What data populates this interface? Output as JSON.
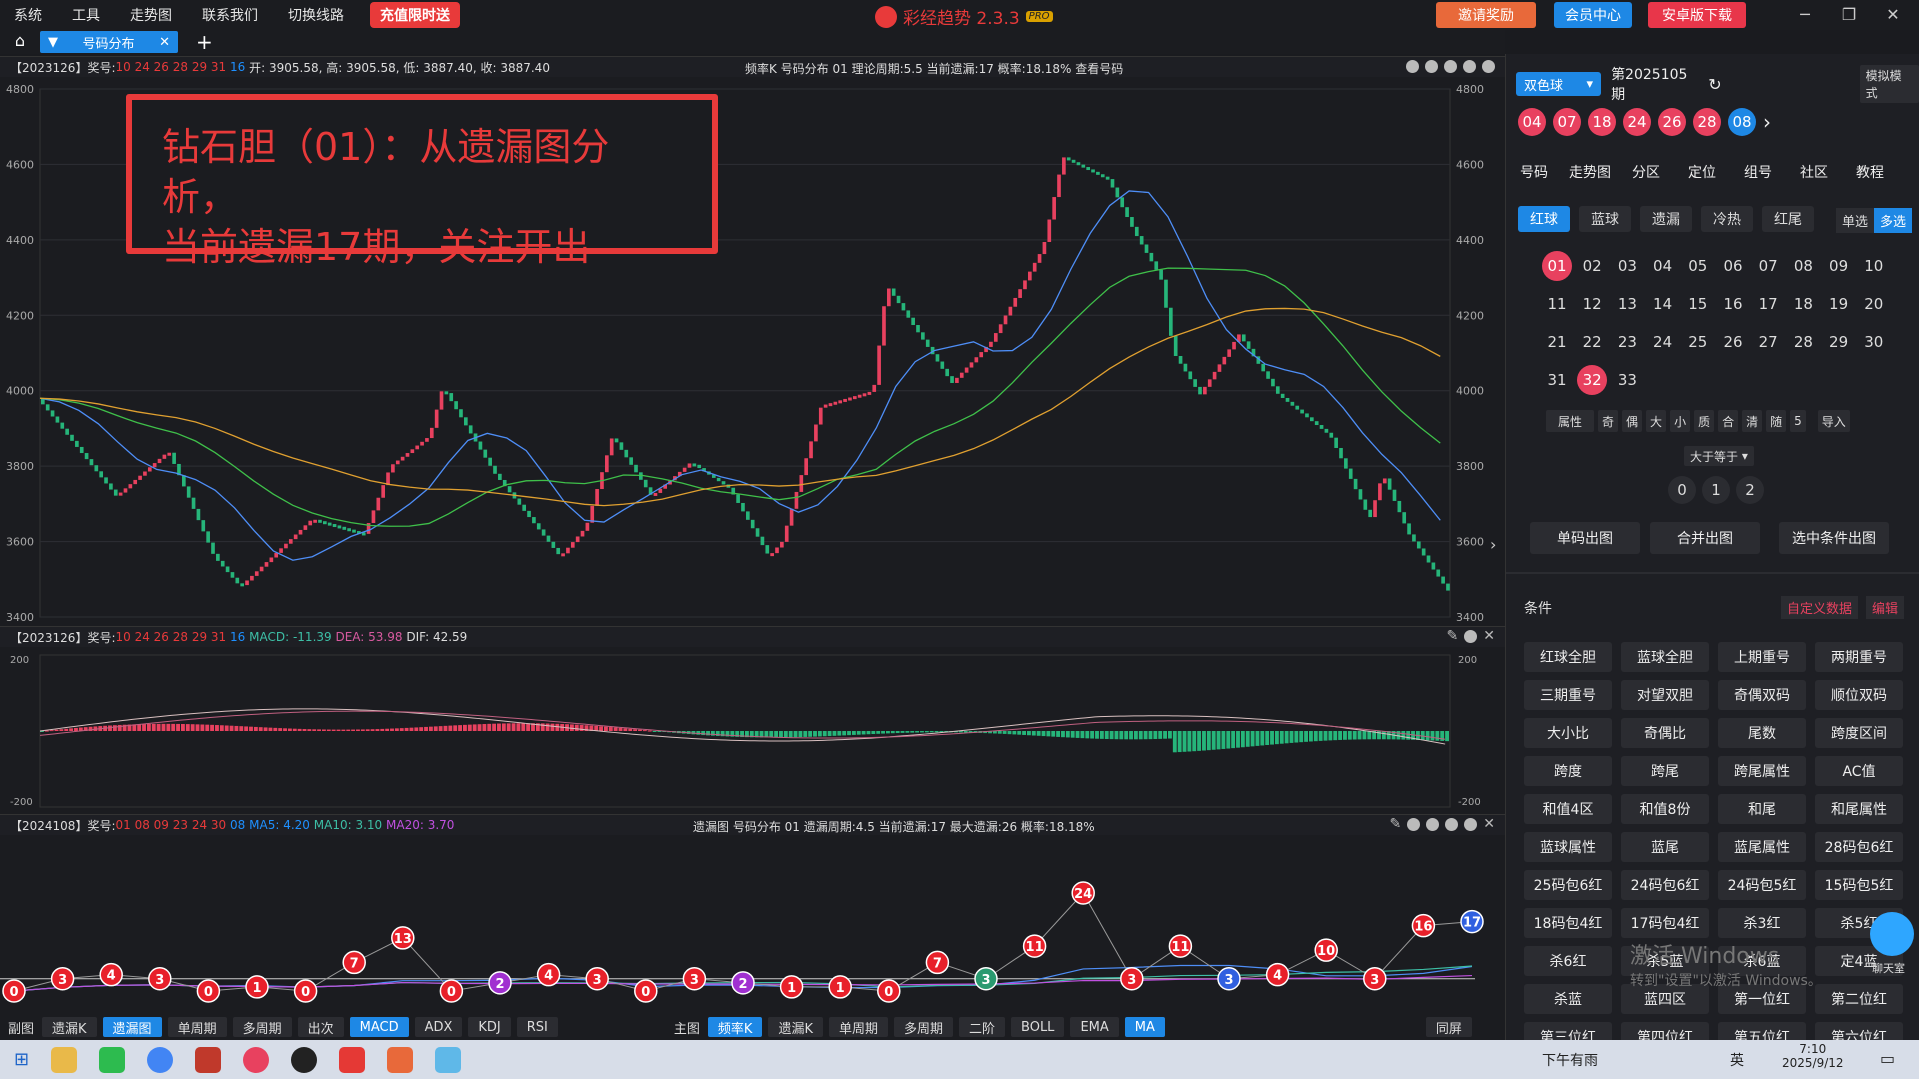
{
  "menu": [
    "系统",
    "工具",
    "走势图",
    "联系我们",
    "切换线路"
  ],
  "promo": "充值限时送",
  "app": {
    "name": "彩经趋势 2.3.3",
    "badge": "PRO"
  },
  "top_buttons": {
    "invite": "邀请奖励",
    "member": "会员中心",
    "android": "安卓版下载"
  },
  "tab": {
    "label": "号码分布"
  },
  "panel1": {
    "issue": "【2023126】奖号:",
    "balls_red": "10 24 26 28 29 31",
    "ball_blue": "16",
    "ohlc": "开: 3905.58, 高: 3905.58, 低: 3887.40, 收: 3887.40",
    "center": "频率K 号码分布 01 理论周期:5.5 当前遗漏:17 概率:18.18% 查看号码",
    "yticks": [
      "4800",
      "4600",
      "4400",
      "4200",
      "4000",
      "3800",
      "3600",
      "3400"
    ]
  },
  "annotation": {
    "line1": "钻石胆（01）：从遗漏图分析，",
    "line2": "当前遗漏17期，关注开出"
  },
  "panel2": {
    "issue": "【2023126】奖号:",
    "balls_red": "10 24 26 28 29 31",
    "ball_blue": "16",
    "macd": "MACD: -11.39",
    "dea": "DEA: 53.98",
    "dif": "DIF: 42.59",
    "yticks": [
      "200",
      "-200"
    ]
  },
  "panel3": {
    "issue": "【2024108】奖号:",
    "balls_red": "01 08 09 23 24 30",
    "ball_blue": "08",
    "ma5": "MA5: 4.20",
    "ma10": "MA10: 3.10",
    "ma20": "MA20: 3.70",
    "center": "遗漏图 号码分布 01 遗漏周期:4.5 当前遗漏:17 最大遗漏:26 概率:18.18%",
    "values": [
      0,
      3,
      4,
      3,
      0,
      1,
      0,
      7,
      13,
      0,
      2,
      4,
      3,
      0,
      3,
      2,
      1,
      1,
      0,
      7,
      3,
      11,
      24,
      3,
      11,
      3,
      4,
      10,
      3,
      16,
      17
    ]
  },
  "bottombar": {
    "left_label": "副图",
    "left": [
      "遗漏K",
      "遗漏图",
      "单周期",
      "多周期",
      "出次",
      "MACD",
      "ADX",
      "KDJ",
      "RSI"
    ],
    "main_label": "主图",
    "main": [
      "频率K",
      "遗漏K",
      "单周期",
      "多周期",
      "二阶",
      "BOLL",
      "EMA",
      "MA"
    ],
    "right": "同屏"
  },
  "right": {
    "game": "双色球",
    "period": "第2025105期",
    "mode": "模拟模式",
    "draw_red": [
      "04",
      "07",
      "18",
      "24",
      "26",
      "28"
    ],
    "draw_blue": "08",
    "nav": [
      "号码",
      "走势图",
      "分区",
      "定位",
      "组号",
      "社区",
      "教程"
    ],
    "subtabs": [
      "红球",
      "蓝球",
      "遗漏",
      "冷热",
      "红尾"
    ],
    "single": "单选",
    "multi": "多选",
    "numbers": [
      "01",
      "02",
      "03",
      "04",
      "05",
      "06",
      "07",
      "08",
      "09",
      "10",
      "11",
      "12",
      "13",
      "14",
      "15",
      "16",
      "17",
      "18",
      "19",
      "20",
      "21",
      "22",
      "23",
      "24",
      "25",
      "26",
      "27",
      "28",
      "29",
      "30",
      "31",
      "32",
      "33"
    ],
    "selected": [
      "01",
      "32"
    ],
    "attrs": [
      "属性",
      "奇",
      "偶",
      "大",
      "小",
      "质",
      "合",
      "清",
      "随",
      "5",
      "导入"
    ],
    "compare": "大于等于",
    "counts": [
      "0",
      "1",
      "2"
    ],
    "actions": [
      "单码出图",
      "合并出图",
      "选中条件出图"
    ],
    "cond_label": "条件",
    "custom": "自定义数据",
    "edit": "编辑",
    "conditions": [
      "红球全胆",
      "蓝球全胆",
      "上期重号",
      "两期重号",
      "三期重号",
      "对望双胆",
      "奇偶双码",
      "顺位双码",
      "大小比",
      "奇偶比",
      "尾数",
      "跨度区间",
      "跨度",
      "跨尾",
      "跨尾属性",
      "AC值",
      "和值4区",
      "和值8份",
      "和尾",
      "和尾属性",
      "蓝球属性",
      "蓝尾",
      "蓝尾属性",
      "28码包6红",
      "25码包6红",
      "24码包6红",
      "24码包5红",
      "15码包5红",
      "18码包4红",
      "17码包4红",
      "杀3红",
      "杀5红",
      "杀6红",
      "杀5蓝",
      "杀6蓝",
      "定4蓝",
      "杀蓝",
      "蓝四区",
      "第一位红",
      "第二位红",
      "第三位红",
      "第四位红",
      "第五位红",
      "第六位红"
    ]
  },
  "watermark": {
    "line1": "激活 Windows",
    "line2": "转到\"设置\"以激活 Windows。"
  },
  "chat": "聊天室",
  "taskbar": {
    "weather": "下午有雨",
    "time": "7:10",
    "date": "2025/9/12",
    "ime": "英"
  }
}
